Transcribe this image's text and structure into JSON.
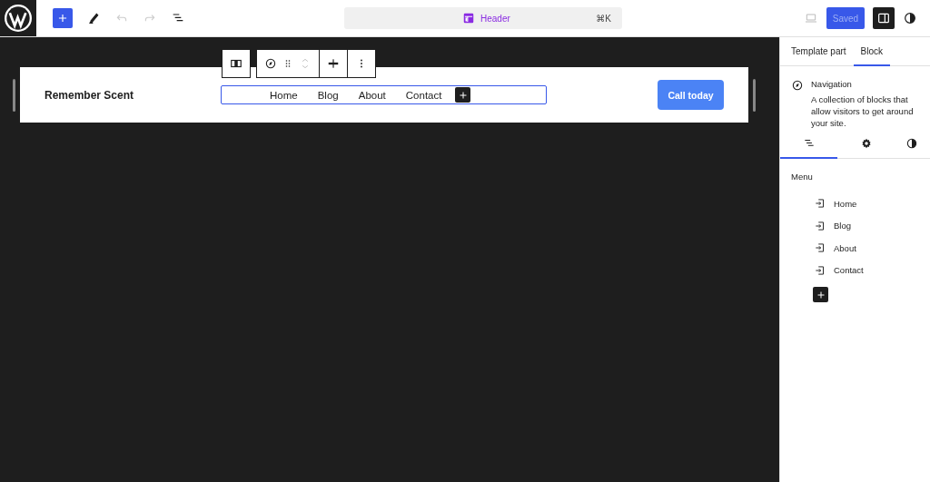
{
  "topbar": {
    "title": "Header",
    "shortcut": "⌘K",
    "save_button": "Saved",
    "sidebar_toggle_on": true
  },
  "header_block": {
    "site_title": "Remember Scent",
    "nav_items": [
      "Home",
      "Blog",
      "About",
      "Contact"
    ],
    "cta": "Call today"
  },
  "sidebar": {
    "tabs": [
      {
        "label": "Template part",
        "selected": false
      },
      {
        "label": "Block",
        "selected": true
      }
    ],
    "block": {
      "name": "Navigation",
      "description": "A collection of blocks that allow visitors to get around your site."
    },
    "subtabs": [
      {
        "kind": "list",
        "selected": true
      },
      {
        "kind": "settings",
        "selected": false
      },
      {
        "kind": "styles",
        "selected": false
      }
    ],
    "menu": {
      "heading": "Menu",
      "items": [
        "Home",
        "Blog",
        "About",
        "Contact"
      ]
    }
  }
}
